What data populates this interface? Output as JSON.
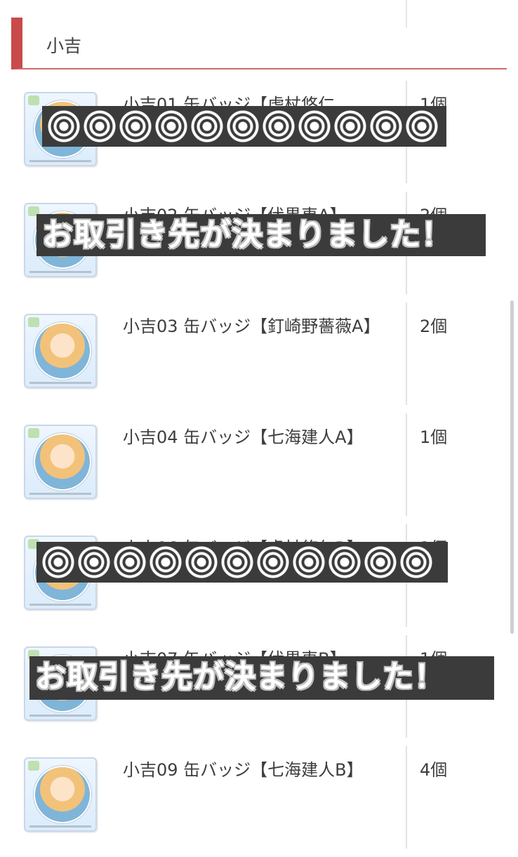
{
  "section": {
    "title": "小吉"
  },
  "items": [
    {
      "name": "小吉01 缶バッジ【虎杖悠仁",
      "qty": "1個"
    },
    {
      "name": "小吉02 缶バッジ【伏黒恵A】",
      "qty": "2個"
    },
    {
      "name": "小吉03 缶バッジ【釘崎野薔薇A】",
      "qty": "2個"
    },
    {
      "name": "小吉04 缶バッジ【七海建人A】",
      "qty": "1個"
    },
    {
      "name": "小吉06 缶バッジ【虎杖悠仁B】",
      "qty": "2個"
    },
    {
      "name": "小吉07 缶バッジ【伏黒恵B】",
      "qty": "1個"
    },
    {
      "name": "小吉09 缶バッジ【七海建人B】",
      "qty": "4個"
    }
  ],
  "overlays": {
    "deal_done_1": "お取引き先が決まりました！",
    "deal_done_2": "お取引き先が決まりました！"
  }
}
